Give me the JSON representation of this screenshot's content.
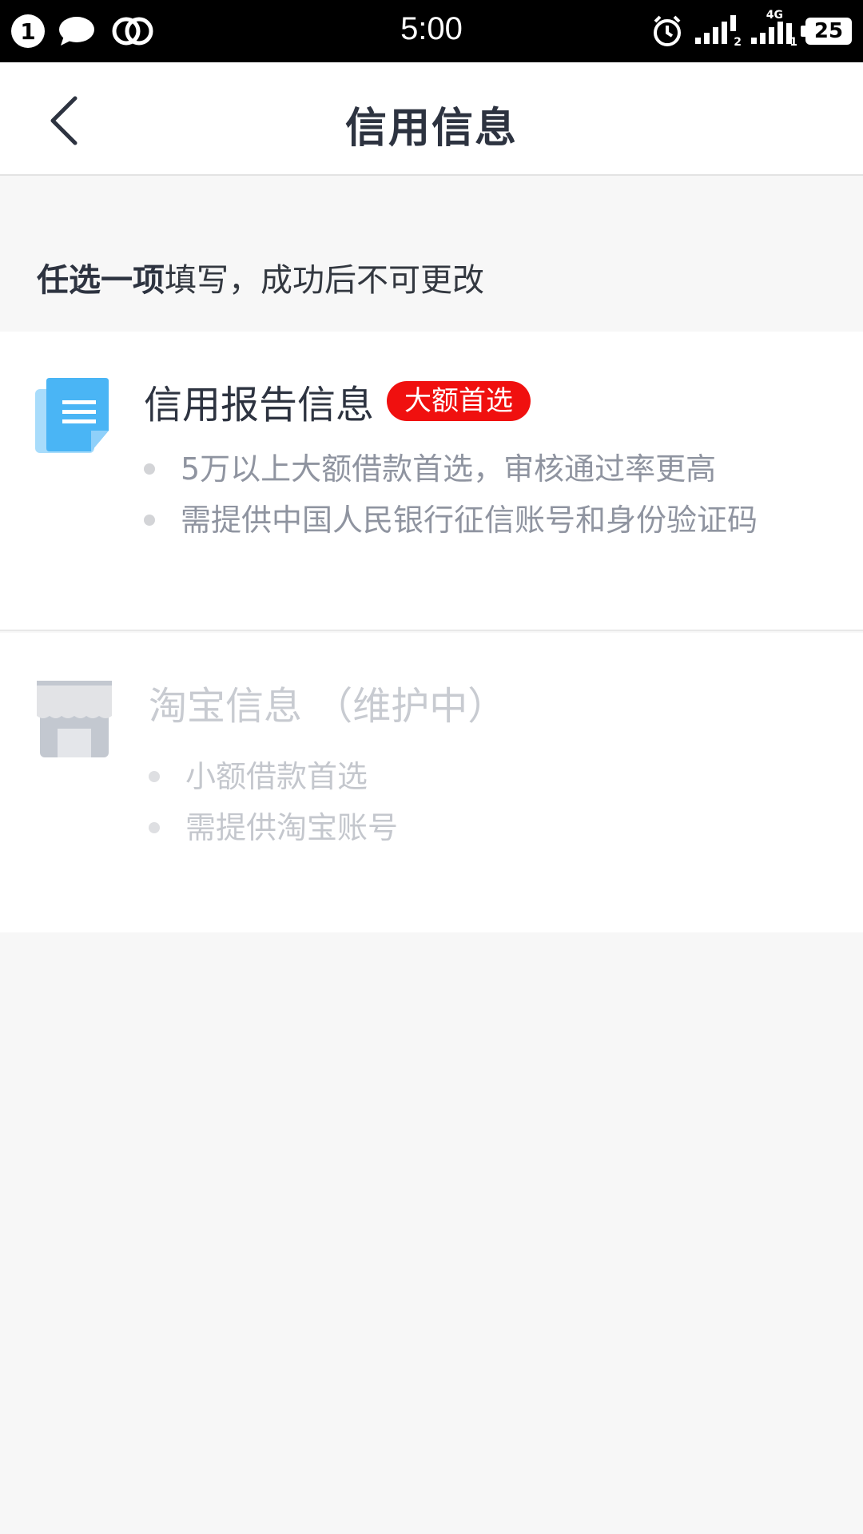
{
  "status_bar": {
    "notification_count": "1",
    "time": "5:00",
    "sim1_label": "2",
    "sim2_network": "4G",
    "sim2_label": "1",
    "battery": "25"
  },
  "header": {
    "title": "信用信息"
  },
  "hint": {
    "bold": "任选一项",
    "rest": "填写，成功后不可更改"
  },
  "options": [
    {
      "title": "信用报告信息",
      "badge": "大额首选",
      "bullets": [
        "5万以上大额借款首选，审核通过率更高",
        "需提供中国人民银行征信账号和身份验证码"
      ],
      "icon": "document-icon",
      "accent": "#4ab5f5"
    },
    {
      "title": "淘宝信息 （维护中）",
      "bullets": [
        "小额借款首选",
        "需提供淘宝账号"
      ],
      "icon": "store-icon",
      "disabled": true
    }
  ],
  "colors": {
    "badge_red": "#f0100f",
    "title_dark": "#2d3340",
    "bullet_gray": "#8f94a0",
    "disabled_gray": "#c8cbd1",
    "page_bg": "#f7f7f7"
  }
}
